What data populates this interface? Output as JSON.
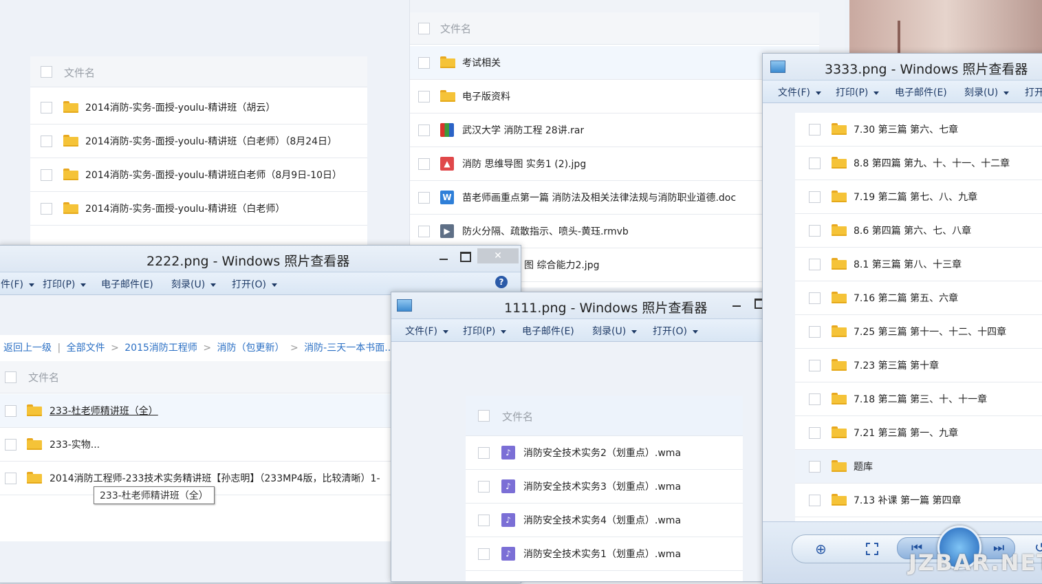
{
  "panel_topleft": {
    "header": "文件名",
    "rows": [
      "2014消防-实务-面授-youlu-精讲班（胡云）",
      "2014消防-实务-面授-youlu-精讲班（白老师）（8月24日）",
      "2014消防-实务-面授-youlu-精讲班白老师（8月9日-10日）",
      "2014消防-实务-面授-youlu-精讲班（白老师）"
    ]
  },
  "panel_topmid": {
    "header": "文件名",
    "rows": [
      {
        "name": "考试相关",
        "icon": "folder-icon"
      },
      {
        "name": "电子版资料",
        "icon": "folder-icon"
      },
      {
        "name": "武汉大学 消防工程 28讲.rar",
        "icon": "archive-icon"
      },
      {
        "name": "消防  思维导图 实务1 (2).jpg",
        "icon": "image-file-icon"
      },
      {
        "name": "苗老师画重点第一篇 消防法及相关法律法规与消防职业道德.doc",
        "icon": "word-doc-icon"
      },
      {
        "name": "防火分隔、疏散指示、喷头-黄珏.rmvb",
        "icon": "video-file-icon"
      },
      {
        "name": "图 综合能力2.jpg",
        "icon": "image-file-icon"
      }
    ]
  },
  "window_2222": {
    "title": "2222.png - Windows 照片查看器",
    "menu": [
      "件(F)",
      "打印(P)",
      "电子邮件(E)",
      "刻录(U)",
      "打开(O)"
    ],
    "close_label": "✕",
    "breadcrumb": {
      "back": "返回上一级",
      "sep": "|",
      "items": [
        "全部文件",
        "2015消防工程师",
        "消防（包更新）",
        "消防-三天一本书面..."
      ]
    },
    "header": "文件名",
    "rows": [
      "233-杜老师精讲班（全）",
      "233-实物...",
      "2014消防工程师-233技术实务精讲班【孙志明】（233MP4版，比较清晰）1-"
    ],
    "tooltip": "233-杜老师精讲班（全）"
  },
  "window_1111": {
    "title": "1111.png - Windows 照片查看器",
    "menu": [
      "文件(F)",
      "打印(P)",
      "电子邮件(E)",
      "刻录(U)",
      "打开(O)"
    ],
    "header": "文件名",
    "rows": [
      "消防安全技术实务2（划重点）.wma",
      "消防安全技术实务3（划重点）.wma",
      "消防安全技术实务4（划重点）.wma",
      "消防安全技术实务1（划重点）.wma"
    ]
  },
  "window_3333": {
    "title": "3333.png - Windows 照片查看器",
    "menu": [
      "文件(F)",
      "打印(P)",
      "电子邮件(E)",
      "刻录(U)",
      "打开"
    ],
    "rows": [
      "7.30 第三篇 第六、七章",
      "8.8 第四篇 第九、十、十一、十二章",
      "7.19 第二篇 第七、八、九章",
      "8.6 第四篇 第六、七、八章",
      "8.1 第三篇 第八、十三章",
      "7.16 第二篇 第五、六章",
      "7.25 第三篇 第十一、十二、十四章",
      "7.23 第三篇 第十章",
      "7.18 第二篇 第三、十、十一章",
      "7.21 第三篇 第一、九章",
      "题库",
      "7.13 补课 第一篇 第四章"
    ],
    "watermark": "JZBAR.NET"
  },
  "colors": {
    "folder": "#f5c338",
    "link": "#2a6fc4",
    "accent": "#3d8bd0"
  }
}
